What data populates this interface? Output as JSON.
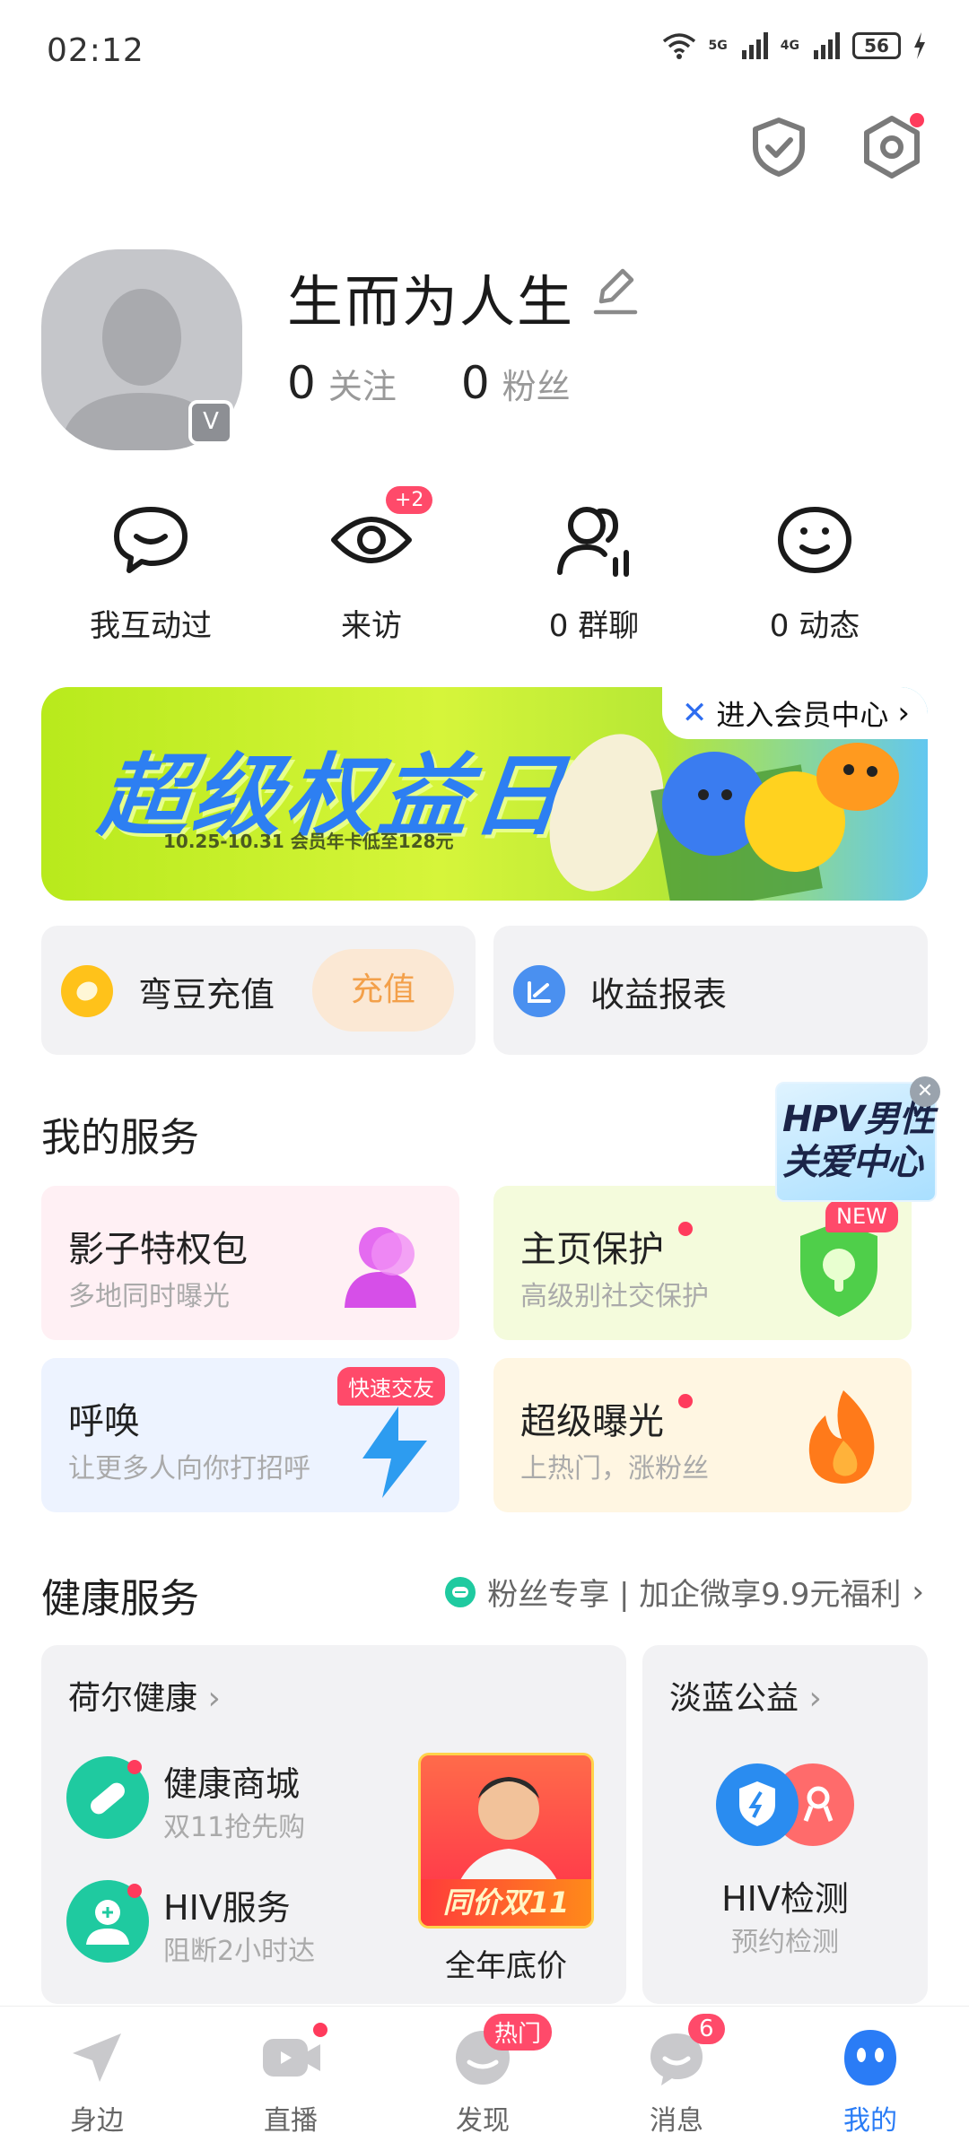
{
  "status_bar": {
    "time": "02:12",
    "net1": "5G",
    "net2": "4G",
    "battery": "56"
  },
  "top_icons": [
    "shield-check-icon",
    "settings-icon"
  ],
  "profile": {
    "nickname": "生而为人生",
    "following_count": "0",
    "following_label": "关注",
    "fans_count": "0",
    "fans_label": "粉丝",
    "avatar_badge": "V"
  },
  "quick_actions": [
    {
      "icon": "chat-bubble-icon",
      "label": "我互动过"
    },
    {
      "icon": "eye-icon",
      "label": "来访",
      "badge": "+2"
    },
    {
      "icon": "group-chat-icon",
      "label": "0 群聊"
    },
    {
      "icon": "moments-icon",
      "label": "0 动态"
    }
  ],
  "banner": {
    "title": "超级权益日",
    "subtitle": "10.25-10.31 会员年卡低至128元",
    "vip_entry": "进入会员中心"
  },
  "wallet": {
    "recharge_label": "弯豆充值",
    "recharge_button": "充值",
    "income_label": "收益报表"
  },
  "my_services": {
    "title": "我的服务",
    "cards": [
      {
        "title": "影子特权包",
        "subtitle": "多地同时曝光"
      },
      {
        "title": "主页保护",
        "subtitle": "高级别社交保护",
        "tag": "NEW"
      },
      {
        "title": "呼唤",
        "subtitle": "让更多人向你打招呼",
        "tag": "快速交友"
      },
      {
        "title": "超级曝光",
        "subtitle": "上热门，涨粉丝"
      }
    ],
    "sticker": "HPV男性关爱中心"
  },
  "health": {
    "title": "健康服务",
    "tip": "粉丝专享 | 加企微享9.9元福利",
    "left_category": "荷尔健康",
    "items": [
      {
        "title": "健康商城",
        "subtitle": "双11抢先购"
      },
      {
        "title": "HIV服务",
        "subtitle": "阻断2小时达"
      }
    ],
    "promo_caption": "同价双11",
    "promo_label": "全年底价",
    "right_category": "淡蓝公益",
    "right_title": "HIV检测",
    "right_subtitle": "预约检测"
  },
  "bottom_nav": [
    {
      "label": "身边",
      "icon": "location-arrow-icon"
    },
    {
      "label": "直播",
      "icon": "live-video-icon"
    },
    {
      "label": "发现",
      "icon": "discover-icon",
      "badge": "热门"
    },
    {
      "label": "消息",
      "icon": "message-icon",
      "badge": "6"
    },
    {
      "label": "我的",
      "icon": "me-icon",
      "active": true
    }
  ],
  "colors": {
    "accent": "#2a7cf6",
    "badge": "#ff4a6a",
    "teal": "#1fcaa0"
  }
}
